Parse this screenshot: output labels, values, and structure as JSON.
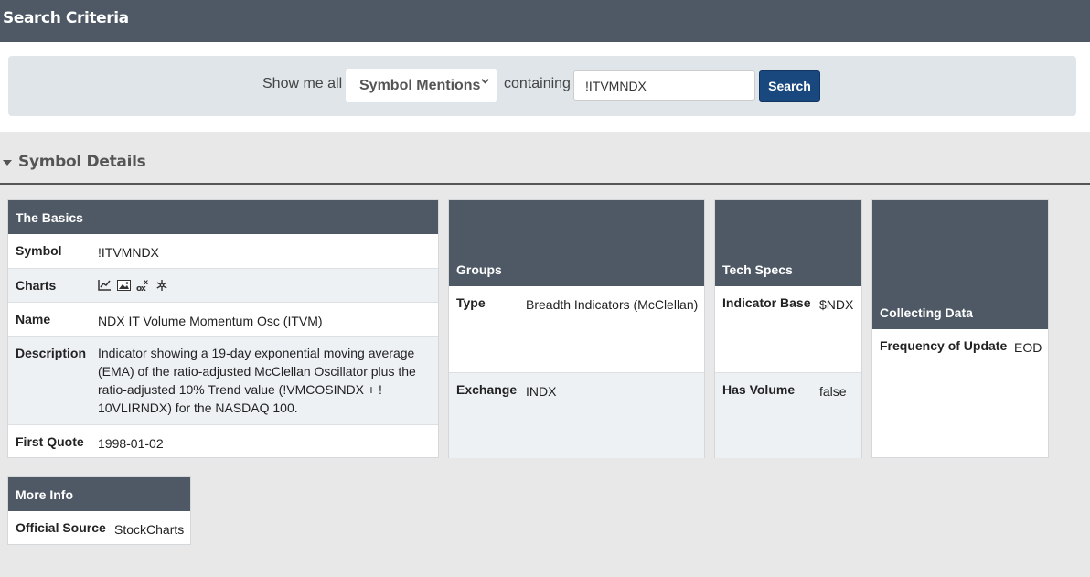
{
  "header": {
    "title": "Search Criteria"
  },
  "search": {
    "prefix": "Show me all",
    "selected": "Symbol Mentions",
    "middle": "containing",
    "value": "!ITVMNDX",
    "button": "Search"
  },
  "section": {
    "title": "Symbol Details"
  },
  "basics": {
    "title": "The Basics",
    "symbol_label": "Symbol",
    "symbol": "!ITVMNDX",
    "charts_label": "Charts",
    "chart_icons": [
      "line-chart-icon",
      "image-chart-icon",
      "seasonality-icon",
      "snowflake-icon"
    ],
    "name_label": "Name",
    "name": "NDX IT Volume Momentum Osc (ITVM)",
    "desc_label": "Description",
    "desc_lines": [
      "Indicator showing a 19-day exponential moving average",
      "(EMA) of the ratio-adjusted McClellan Oscillator plus the",
      "ratio-adjusted 10% Trend value (!VMCOSINDX + !",
      "10VLIRNDX) for the NASDAQ 100."
    ],
    "first_quote_label": "First Quote",
    "first_quote": "1998-01-02"
  },
  "groups": {
    "title": "Groups",
    "type_label": "Type",
    "type": "Breadth Indicators (McClellan)",
    "exchange_label": "Exchange",
    "exchange": "INDX"
  },
  "tech": {
    "title": "Tech Specs",
    "base_label": "Indicator Base",
    "base": "$NDX",
    "volume_label": "Has Volume",
    "volume": "false"
  },
  "collecting": {
    "title": "Collecting Data",
    "freq_label": "Frequency of Update",
    "freq": "EOD"
  },
  "more": {
    "title": "More Info",
    "source_label": "Official Source",
    "source": "StockCharts"
  }
}
